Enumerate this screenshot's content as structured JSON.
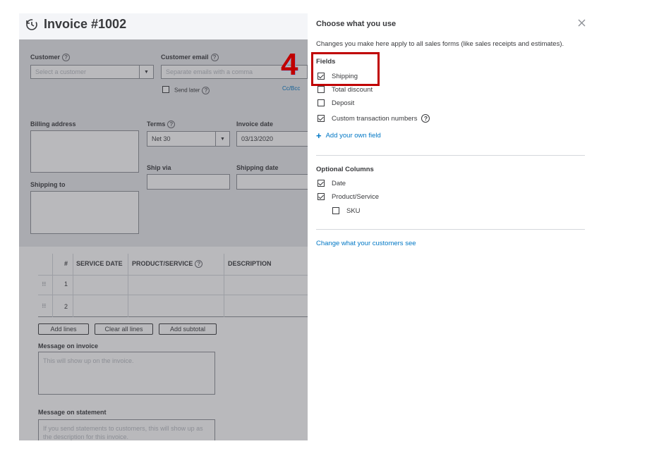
{
  "invoice": {
    "title": "Invoice #1002",
    "customer_label": "Customer",
    "customer_placeholder": "Select a customer",
    "email_label": "Customer email",
    "email_placeholder": "Separate emails with a comma",
    "send_later_label": "Send later",
    "cc_bcc_label": "Cc/Bcc",
    "billing_address_label": "Billing address",
    "terms_label": "Terms",
    "terms_value": "Net 30",
    "invoice_date_label": "Invoice date",
    "invoice_date_value": "03/13/2020",
    "ship_via_label": "Ship via",
    "shipping_date_label": "Shipping date",
    "shipping_to_label": "Shipping to",
    "table": {
      "columns": [
        "#",
        "SERVICE DATE",
        "PRODUCT/SERVICE",
        "DESCRIPTION"
      ],
      "rows": [
        "1",
        "2"
      ]
    },
    "buttons": {
      "add_lines": "Add lines",
      "clear_all_lines": "Clear all lines",
      "add_subtotal": "Add subtotal"
    },
    "message_on_invoice_label": "Message on invoice",
    "message_on_invoice_placeholder": "This will show up on the invoice.",
    "message_on_statement_label": "Message on statement",
    "message_on_statement_placeholder": "If you send statements to customers, this will show up as the description for this invoice."
  },
  "panel": {
    "title": "Choose what you use",
    "description": "Changes you make here apply to all sales forms (like sales receipts and estimates).",
    "fields_heading": "Fields",
    "fields": [
      {
        "label": "Shipping",
        "checked": true
      },
      {
        "label": "Total discount",
        "checked": false
      },
      {
        "label": "Deposit",
        "checked": false
      },
      {
        "label": "Custom transaction numbers",
        "checked": true
      }
    ],
    "add_field_link": "Add your own field",
    "optional_columns_heading": "Optional Columns",
    "columns": [
      {
        "label": "Date",
        "checked": true
      },
      {
        "label": "Product/Service",
        "checked": true
      },
      {
        "label": "SKU",
        "checked": false
      }
    ],
    "customers_see_link": "Change what your customers see"
  },
  "annotation": {
    "step_number": "4",
    "highlight_color": "#c00000"
  },
  "colors": {
    "link": "#0077c5",
    "text": "#393a3d"
  }
}
